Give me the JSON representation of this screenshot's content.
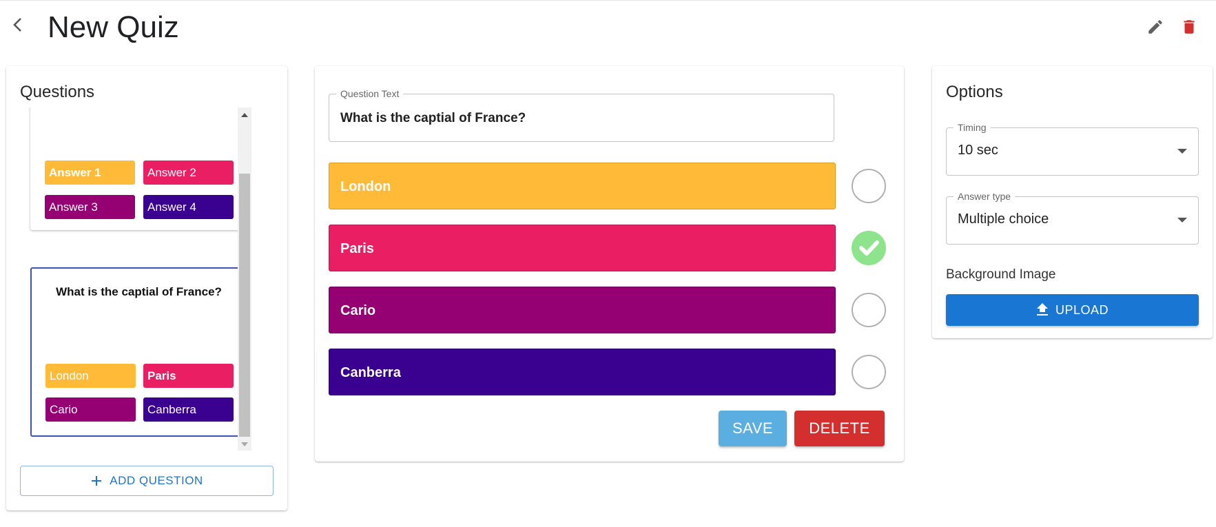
{
  "header": {
    "title": "New Quiz",
    "back_icon": "chevron-left-icon",
    "edit_icon": "pencil-icon",
    "delete_icon": "trash-icon",
    "delete_icon_color": "#d32f2f"
  },
  "questions_panel": {
    "heading": "Questions",
    "cards": [
      {
        "text": "",
        "answers": [
          {
            "label": "Answer 1",
            "color": "#ffbb38",
            "bold": true
          },
          {
            "label": "Answer 2",
            "color": "#e91e63",
            "bold": false
          },
          {
            "label": "Answer 3",
            "color": "#950073",
            "bold": false
          },
          {
            "label": "Answer 4",
            "color": "#3a008f",
            "bold": false
          }
        ]
      },
      {
        "text": "What is the captial of France?",
        "selected": true,
        "answers": [
          {
            "label": "London",
            "color": "#ffbb38",
            "bold": false
          },
          {
            "label": "Paris",
            "color": "#e91e63",
            "bold": true
          },
          {
            "label": "Cario",
            "color": "#950073",
            "bold": false
          },
          {
            "label": "Canberra",
            "color": "#3a008f",
            "bold": false
          }
        ]
      }
    ],
    "add_button": "ADD QUESTION"
  },
  "editor": {
    "question_label": "Question Text",
    "question_value": "What is the captial of France?",
    "answers": [
      {
        "label": "London",
        "color": "#ffbb38",
        "correct": false
      },
      {
        "label": "Paris",
        "color": "#e91e63",
        "correct": true
      },
      {
        "label": "Cario",
        "color": "#950073",
        "correct": false
      },
      {
        "label": "Canberra",
        "color": "#3a008f",
        "correct": false
      }
    ],
    "save_button": "SAVE",
    "save_color": "#5aaee0",
    "delete_button": "DELETE",
    "delete_color": "#d32f2f"
  },
  "options": {
    "heading": "Options",
    "timing_label": "Timing",
    "timing_value": "10 sec",
    "answer_type_label": "Answer type",
    "answer_type_value": "Multiple choice",
    "background_label": "Background Image",
    "upload_button": "UPLOAD",
    "accent_color": "#1976d2"
  }
}
